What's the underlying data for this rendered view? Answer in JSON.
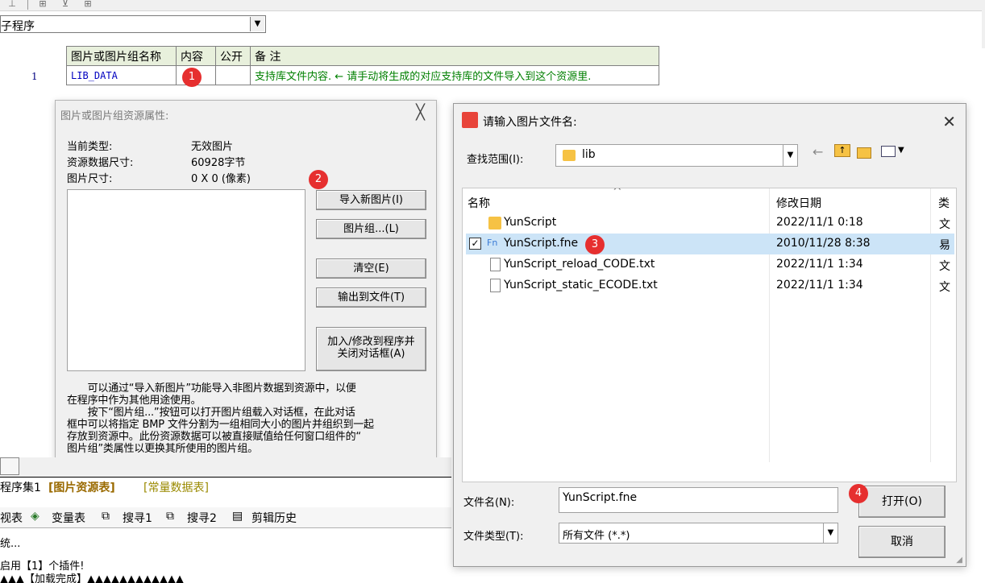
{
  "routine_combo": {
    "value": "子程序"
  },
  "resource_table": {
    "headers": [
      "图片或图片组名称",
      "内容",
      "公开",
      "备 注"
    ],
    "rows": [
      {
        "no": "1",
        "name": "LIB_DATA",
        "content": "",
        "public": "",
        "remark": "支持库文件内容. ← 请手动将生成的对应支持库的文件导入到这个资源里."
      }
    ]
  },
  "badges": {
    "b1": "1",
    "b2": "2",
    "b3": "3",
    "b4": "4"
  },
  "res_dialog": {
    "title": "图片或图片组资源属性:",
    "close": "╳",
    "fields": [
      {
        "label": "当前类型:",
        "value": "无效图片"
      },
      {
        "label": "资源数据尺寸:",
        "value": "60928字节"
      },
      {
        "label": "图片尺寸:",
        "value": "0 X 0 (像素)"
      }
    ],
    "buttons": {
      "import": "导入新图片(I)",
      "group": "图片组...(L)",
      "clear": "清空(E)",
      "export": "输出到文件(T)",
      "add_line1": "加入/修改到程序并",
      "add_line2": "关闭对话框(A)"
    },
    "help": [
      "　　可以通过“导入新图片”功能导入非图片数据到资源中，以便",
      "在程序中作为其他用途使用。",
      "　　按下“图片组...”按钮可以打开图片组载入对话框，在此对话",
      "框中可以将指定 BMP 文件分割为一组相同大小的图片并组织到一起",
      "存放到资源中。此份资源数据可以被直接赋值给任何窗口组件的“",
      "图片组”类属性以更换其所使用的图片组。"
    ]
  },
  "bottom": {
    "tabs": [
      "程序集1",
      "[图片资源表]",
      "[常量数据表]"
    ],
    "panel_tabs": [
      "视表",
      "变量表",
      "搜寻1",
      "搜寻2",
      "剪辑历史"
    ],
    "output": [
      "统...",
      "",
      "启用【1】个插件!",
      "▲▲▲【加载完成】▲▲▲▲▲▲▲▲▲▲▲▲"
    ]
  },
  "file_dialog": {
    "title": "请输入图片文件名:",
    "close": "✕",
    "look_in_label": "查找范围(I):",
    "look_in_value": "lib",
    "columns": [
      "名称",
      "修改日期",
      "类"
    ],
    "files": [
      {
        "name": "YunScript",
        "date": "2022/11/1 0:18",
        "type": "文",
        "kind": "folder",
        "checked": false
      },
      {
        "name": "YunScript.fne",
        "date": "2010/11/28 8:38",
        "type": "易",
        "kind": "fne",
        "checked": true
      },
      {
        "name": "YunScript_reload_CODE.txt",
        "date": "2022/11/1 1:34",
        "type": "文",
        "kind": "txt",
        "checked": false
      },
      {
        "name": "YunScript_static_ECODE.txt",
        "date": "2022/11/1 1:34",
        "type": "文",
        "kind": "txt",
        "checked": false
      }
    ],
    "filename_label": "文件名(N):",
    "filename_value": "YunScript.fne",
    "filetype_label": "文件类型(T):",
    "filetype_value": "所有文件 (*.*)",
    "open_button": "打开(O)",
    "cancel_button": "取消"
  },
  "colors": {
    "badge": "#e62f2f",
    "selection": "#cce4f7",
    "remark": "#008000",
    "header_bg": "#e8f0dc"
  }
}
